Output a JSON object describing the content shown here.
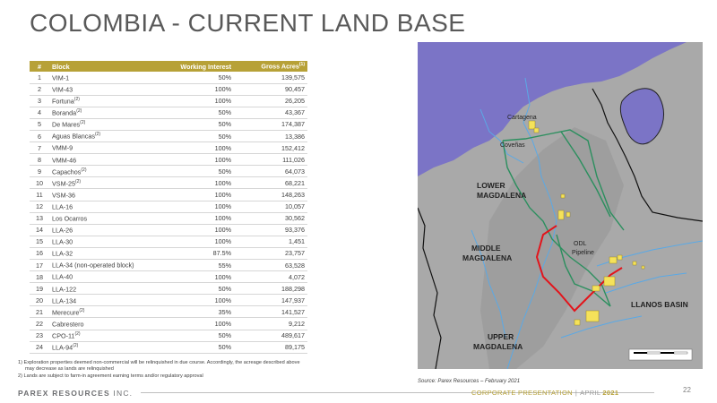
{
  "page": {
    "title": "COLOMBIA - CURRENT LAND BASE",
    "page_number": "22"
  },
  "table": {
    "headers": {
      "num": "#",
      "block": "Block",
      "wi": "Working Interest",
      "ga": "Gross Acres",
      "ga_sup": "(1)"
    },
    "rows": [
      {
        "num": "1",
        "block": "VIM-1",
        "sup": "",
        "wi": "50%",
        "ga": "139,575"
      },
      {
        "num": "2",
        "block": "VIM-43",
        "sup": "",
        "wi": "100%",
        "ga": "90,457"
      },
      {
        "num": "3",
        "block": "Fortuna",
        "sup": "(2)",
        "wi": "100%",
        "ga": "26,205"
      },
      {
        "num": "4",
        "block": "Boranda",
        "sup": "(2)",
        "wi": "50%",
        "ga": "43,367"
      },
      {
        "num": "5",
        "block": "De Mares",
        "sup": "(2)",
        "wi": "50%",
        "ga": "174,387"
      },
      {
        "num": "6",
        "block": "Aguas Blancas",
        "sup": "(2)",
        "wi": "50%",
        "ga": "13,386"
      },
      {
        "num": "7",
        "block": "VMM-9",
        "sup": "",
        "wi": "100%",
        "ga": "152,412"
      },
      {
        "num": "8",
        "block": "VMM-46",
        "sup": "",
        "wi": "100%",
        "ga": "111,026"
      },
      {
        "num": "9",
        "block": "Capachos",
        "sup": "(2)",
        "wi": "50%",
        "ga": "64,073"
      },
      {
        "num": "10",
        "block": "VSM-25",
        "sup": "(2)",
        "wi": "100%",
        "ga": "68,221"
      },
      {
        "num": "11",
        "block": "VSM-36",
        "sup": "",
        "wi": "100%",
        "ga": "148,263"
      },
      {
        "num": "12",
        "block": "LLA-16",
        "sup": "",
        "wi": "100%",
        "ga": "10,057"
      },
      {
        "num": "13",
        "block": "Los Ocarros",
        "sup": "",
        "wi": "100%",
        "ga": "30,562"
      },
      {
        "num": "14",
        "block": "LLA-26",
        "sup": "",
        "wi": "100%",
        "ga": "93,376"
      },
      {
        "num": "15",
        "block": "LLA-30",
        "sup": "",
        "wi": "100%",
        "ga": "1,451"
      },
      {
        "num": "16",
        "block": "LLA-32",
        "sup": "",
        "wi": "87.5%",
        "ga": "23,757"
      },
      {
        "num": "17",
        "block": "LLA-34 (non-operated block)",
        "sup": "",
        "wi": "55%",
        "ga": "63,528"
      },
      {
        "num": "18",
        "block": "LLA-40",
        "sup": "",
        "wi": "100%",
        "ga": "4,072"
      },
      {
        "num": "19",
        "block": "LLA-122",
        "sup": "",
        "wi": "50%",
        "ga": "188,298"
      },
      {
        "num": "20",
        "block": "LLA-134",
        "sup": "",
        "wi": "100%",
        "ga": "147,937"
      },
      {
        "num": "21",
        "block": "Merecure",
        "sup": "(2)",
        "wi": "35%",
        "ga": "141,527"
      },
      {
        "num": "22",
        "block": "Cabrestero",
        "sup": "",
        "wi": "100%",
        "ga": "9,212"
      },
      {
        "num": "23",
        "block": "CPO-11",
        "sup": "(2)",
        "wi": "50%",
        "ga": "489,617"
      },
      {
        "num": "24",
        "block": "LLA-94",
        "sup": "(2)",
        "wi": "50%",
        "ga": "89,175"
      }
    ]
  },
  "footnotes": {
    "n1_line1": "1)   Exploration properties deemed non-commercial will be relinquished in due course. Accordingly, the acreage described above",
    "n1_line2": "may decrease as lands are relinquished",
    "n2": "2)   Lands are subject to farm-in agreement earning terms and/or regulatory approval"
  },
  "map": {
    "labels": {
      "cartagena": "Cartagena",
      "covenas": "Coveñas",
      "lower1": "LOWER",
      "lower2": "MAGDALENA",
      "middle1": "MIDDLE",
      "middle2": "MAGDALENA",
      "odl1": "ODL",
      "odl2": "Pipeline",
      "llanos": "LLANOS BASIN",
      "upper1": "UPPER",
      "upper2": "MAGDALENA"
    },
    "colors": {
      "sea": "#7b74c6",
      "land": "#a9a9a9",
      "river": "#5aa9e6",
      "pipeline": "#2b8f5e",
      "odl": "#e3141b",
      "block": "#f5e25a"
    }
  },
  "source": "Source: Parex Resources – February 2021",
  "footer": {
    "logo": "PAREX RESOURCES",
    "logo_suffix": "INC.",
    "corp": "CORPORATE PRESENTATION",
    "sep": "|",
    "month": "APRIL",
    "year": "2021"
  }
}
